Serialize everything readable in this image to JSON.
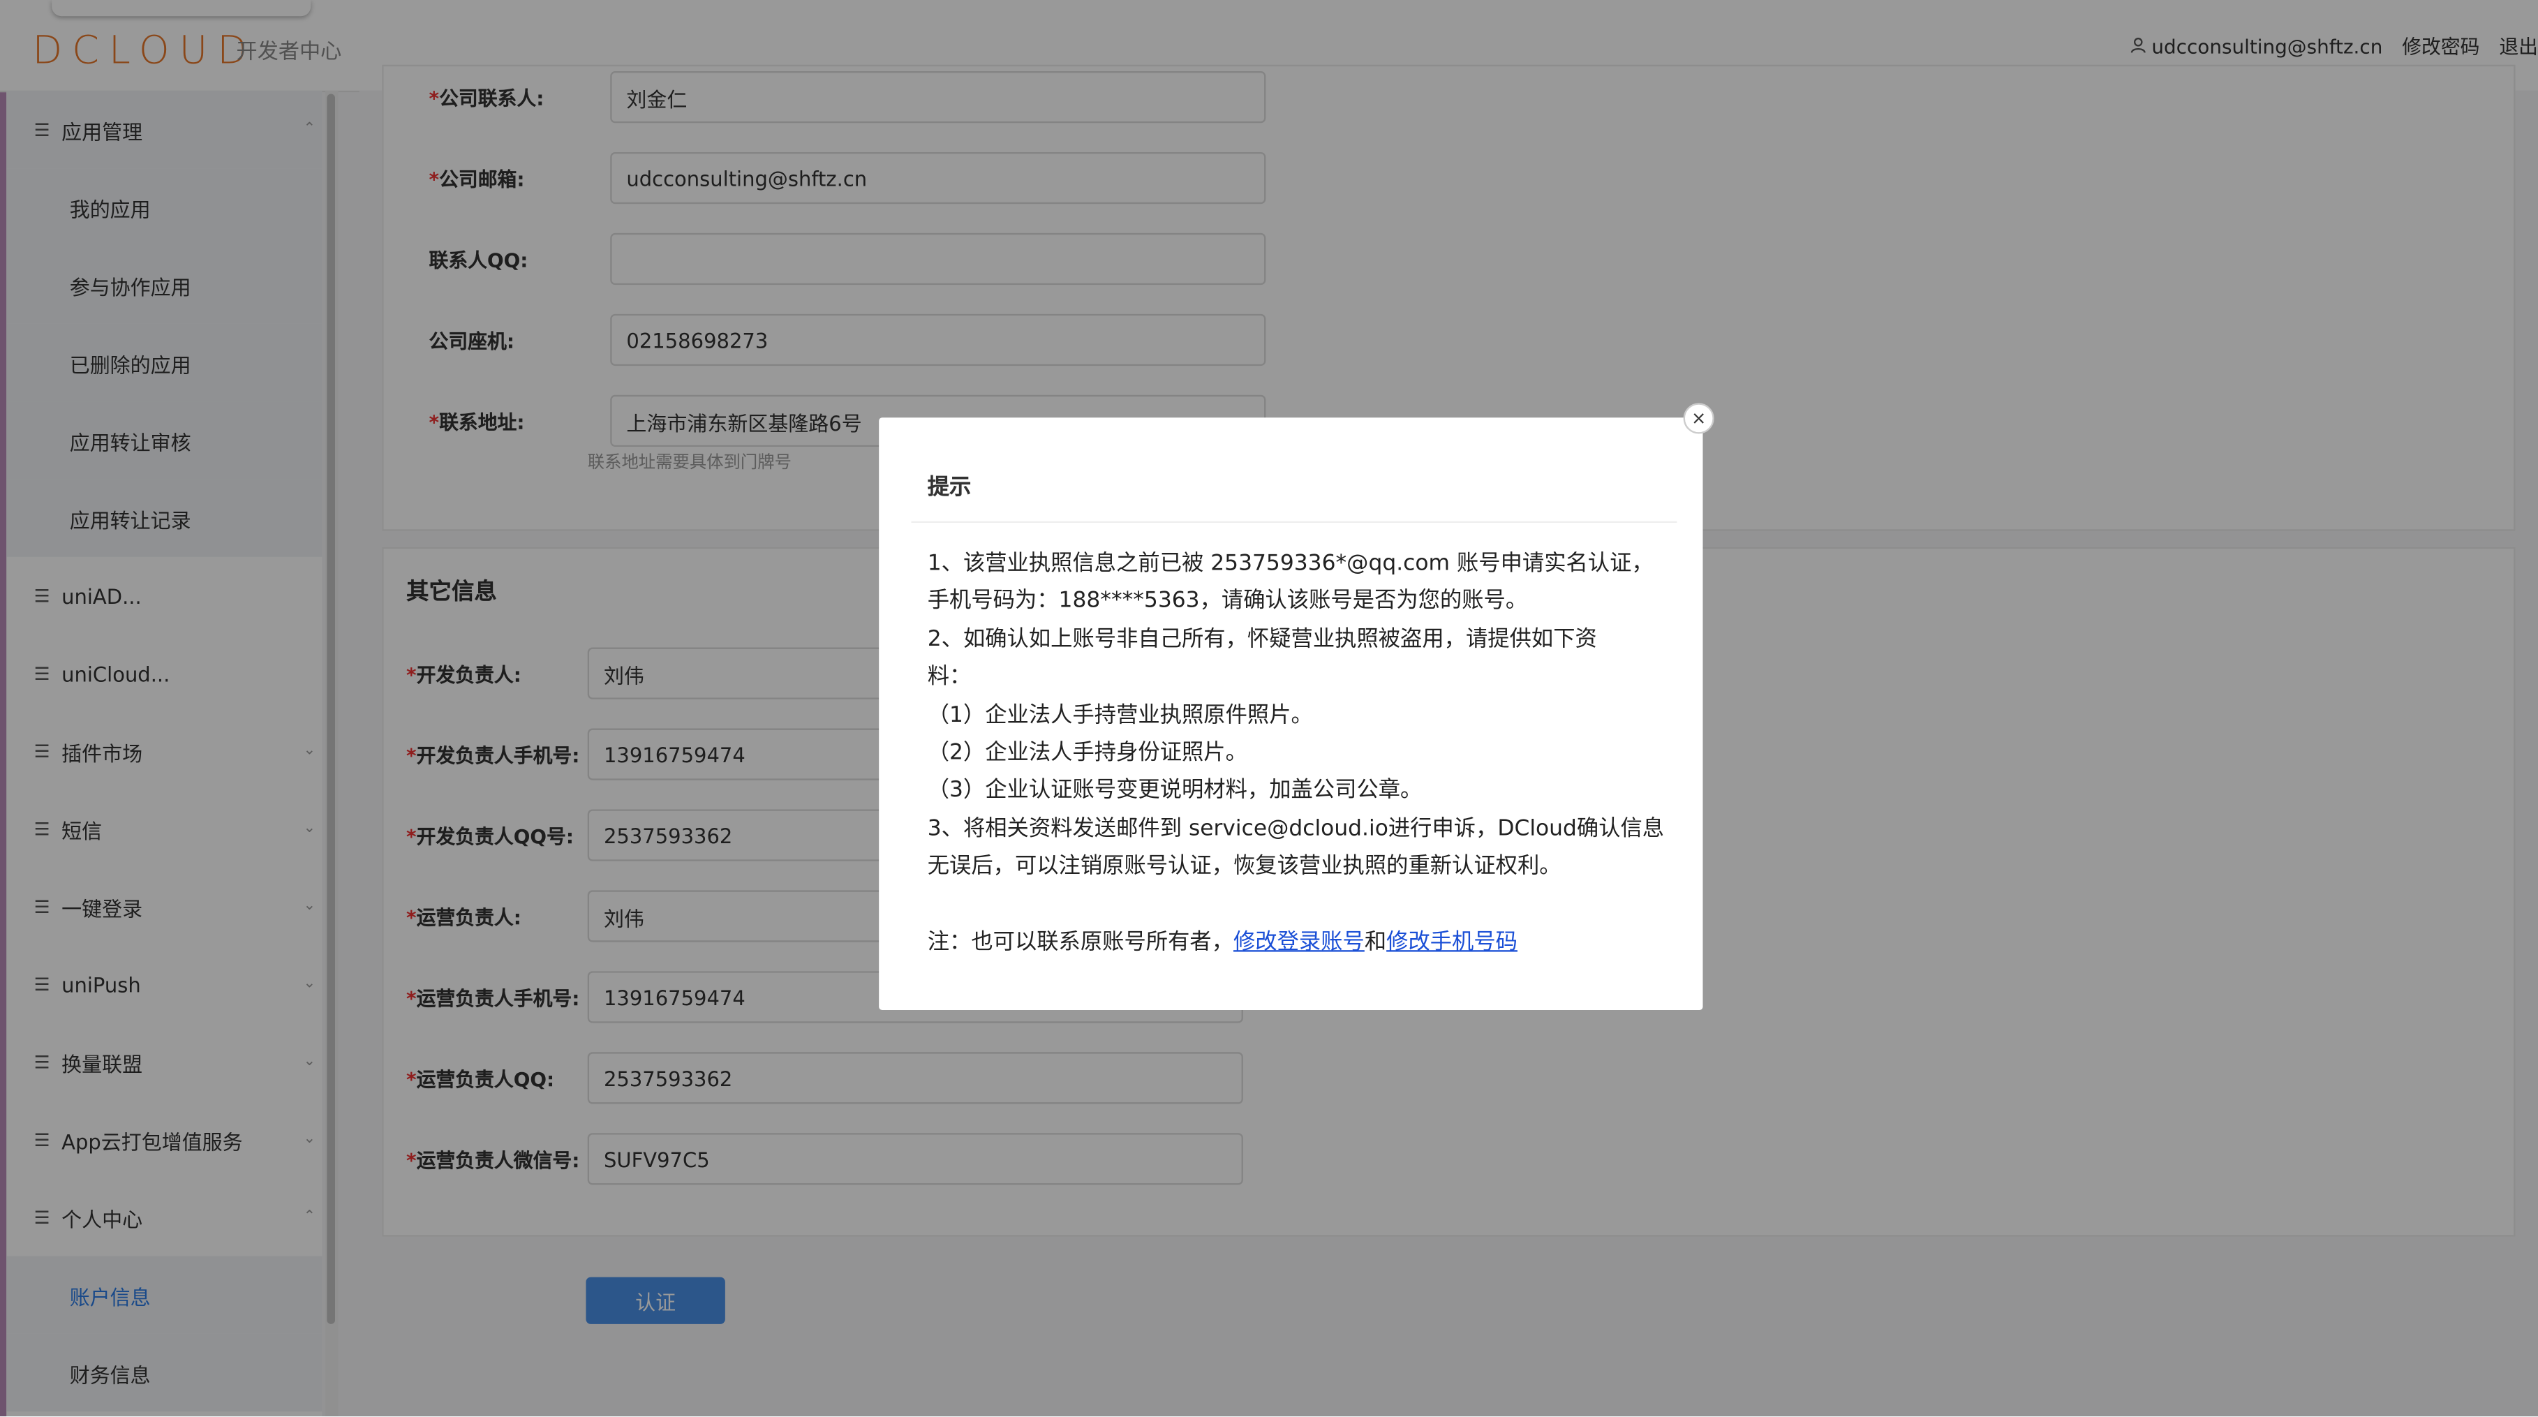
{
  "header": {
    "logo": "DCLOUD",
    "subtitle": "开发者中心",
    "user": "udcconsulting@shftz.cn",
    "change_password": "修改密码",
    "logout": "退出"
  },
  "sidebar": {
    "groups": [
      {
        "label": "应用管理",
        "items": [
          "我的应用",
          "参与协作应用",
          "已删除的应用",
          "应用转让审核",
          "应用转让记录"
        ]
      },
      {
        "label": "uniAD..."
      },
      {
        "label": "uniCloud..."
      },
      {
        "label": "插件市场"
      },
      {
        "label": "短信"
      },
      {
        "label": "一键登录"
      },
      {
        "label": "uniPush"
      },
      {
        "label": "换量联盟"
      },
      {
        "label": "App云打包增值服务"
      },
      {
        "label": "个人中心",
        "items": [
          "账户信息",
          "财务信息"
        ]
      }
    ]
  },
  "form": {
    "company_contact": {
      "label": "公司联系人:",
      "value": "刘金仁"
    },
    "company_email": {
      "label": "公司邮箱:",
      "value": "udcconsulting@shftz.cn"
    },
    "contact_qq": {
      "label": "联系人QQ:",
      "value": ""
    },
    "company_phone": {
      "label": "公司座机:",
      "value": "02158698273"
    },
    "address": {
      "label": "联系地址:",
      "value": "上海市浦东新区基隆路6号",
      "hint": "联系地址需要具体到门牌号"
    },
    "other_section": "其它信息",
    "dev_owner": {
      "label": "开发负责人:",
      "value": "刘伟"
    },
    "dev_phone": {
      "label": "开发负责人手机号:",
      "value": "13916759474"
    },
    "dev_qq": {
      "label": "开发负责人QQ号:",
      "value": "2537593362"
    },
    "ops_owner": {
      "label": "运营负责人:",
      "value": "刘伟"
    },
    "ops_phone": {
      "label": "运营负责人手机号:",
      "value": "13916759474"
    },
    "ops_qq": {
      "label": "运营负责人QQ:",
      "value": "2537593362"
    },
    "ops_wechat": {
      "label": "运营负责人微信号:",
      "value": "SUFV97C5"
    },
    "submit": "认证"
  },
  "modal": {
    "title": "提示",
    "close": "×",
    "lines": [
      "1、该营业执照信息之前已被 253759336*@qq.com 账号申请实名认证，",
      "手机号码为：188****5363，请确认该账号是否为您的账号。",
      "2、如确认如上账号非自己所有，怀疑营业执照被盗用，请提供如下资",
      "料：",
      "（1）企业法人手持营业执照原件照片。",
      "（2）企业法人手持身份证照片。",
      "（3）企业认证账号变更说明材料，加盖公司公章。",
      "3、将相关资料发送邮件到 service@dcloud.io进行申诉，DCloud确认信息",
      "无误后，可以注销原账号认证，恢复该营业执照的重新认证权利。"
    ],
    "note_prefix": "注：也可以联系原账号所有者，",
    "link_change_account": "修改登录账号",
    "and": "和",
    "link_change_phone": "修改手机号码"
  }
}
